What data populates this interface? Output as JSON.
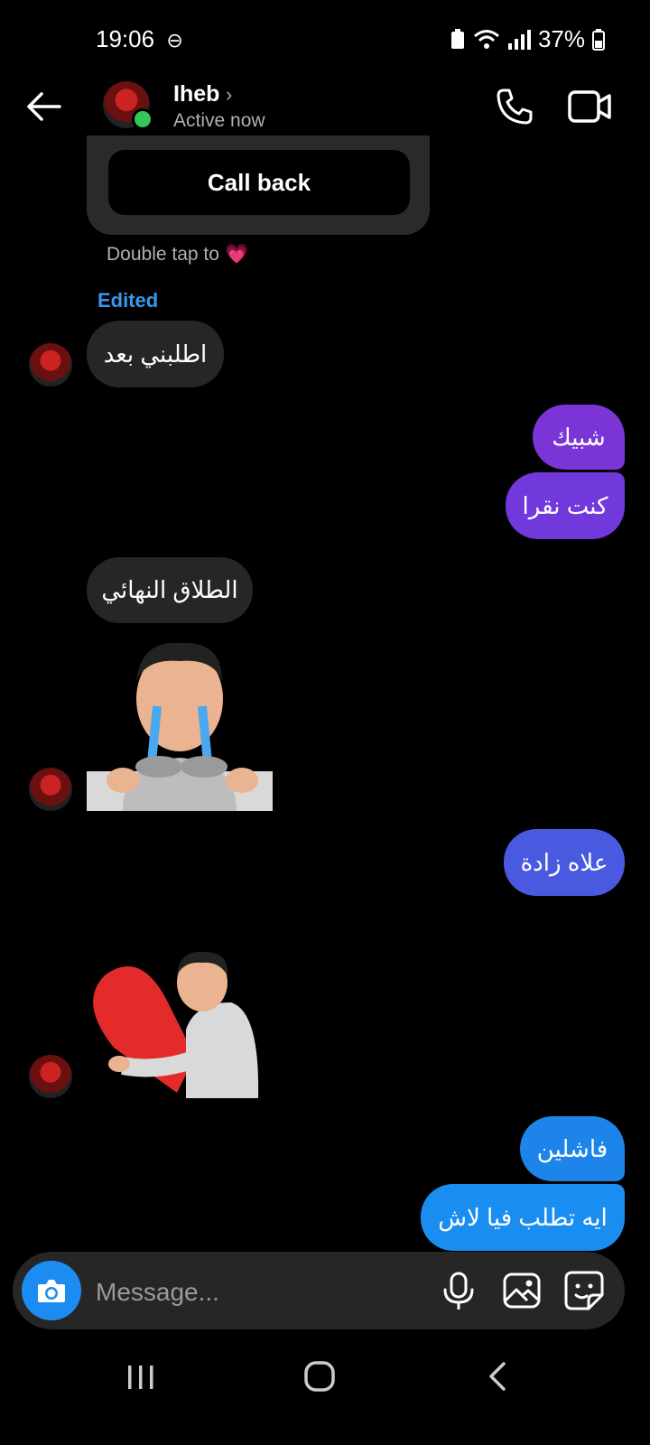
{
  "status_bar": {
    "time": "19:06",
    "battery": "37%"
  },
  "header": {
    "contact_name": "Iheb",
    "contact_status": "Active now",
    "chevron": "›",
    "icons": [
      "back-arrow-icon",
      "phone-icon",
      "video-camera-icon"
    ]
  },
  "call_card": {
    "button_label": "Call back",
    "hint": "Double tap to",
    "hint_emoji": "💗"
  },
  "edited_label": "Edited",
  "messages": [
    {
      "side": "incoming",
      "text": "اطلبني بعد"
    },
    {
      "side": "outgoing",
      "text": "شبيك",
      "color": "#7b35d6"
    },
    {
      "side": "outgoing",
      "text": "كنت نقرا",
      "color": "#7138db"
    },
    {
      "side": "incoming",
      "text": "الطلاق النهائي"
    },
    {
      "side": "incoming",
      "type": "sticker",
      "sticker": "crying-avatar-sticker"
    },
    {
      "side": "outgoing",
      "text": "علاه زادة",
      "color": "#4a5ae0"
    },
    {
      "side": "incoming",
      "type": "sticker",
      "sticker": "heart-hug-avatar-sticker"
    },
    {
      "side": "outgoing",
      "text": "فاشلين",
      "color": "#1d84ea"
    },
    {
      "side": "outgoing",
      "text": "ايه تطلب فيا لاش",
      "color": "#1a8ef0"
    }
  ],
  "composer": {
    "placeholder": "Message...",
    "icons": [
      "camera-icon",
      "microphone-icon",
      "gallery-icon",
      "sticker-icon"
    ]
  },
  "colors": {
    "background": "#000000",
    "incoming_bubble": "#262626",
    "accent_blue": "#3897f0",
    "online": "#35c759"
  }
}
